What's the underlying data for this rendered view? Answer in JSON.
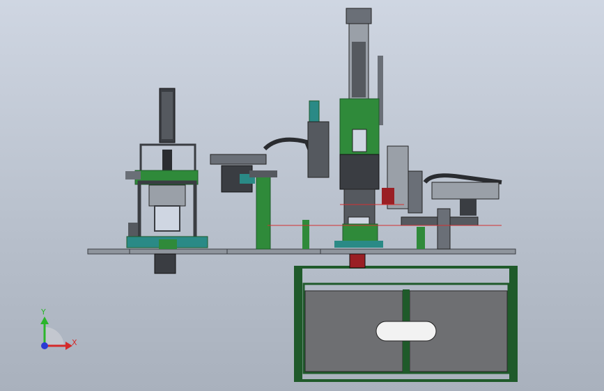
{
  "triad": {
    "y_label": "Y",
    "x_label": "X",
    "y_color": "#2bb52b",
    "x_color": "#d42a2a",
    "z_color": "#2a3bd4"
  },
  "colors": {
    "frame_green": "#1f5a2a",
    "part_green": "#2f8a3a",
    "dark_metal": "#3a3d42",
    "mid_metal": "#6a6f77",
    "light_metal": "#9aa0a8",
    "table_top": "#8f959d",
    "panel_gray": "#6e6f72",
    "teal": "#2a8a86",
    "red_part": "#9a1f24",
    "laser": "#d23030"
  }
}
